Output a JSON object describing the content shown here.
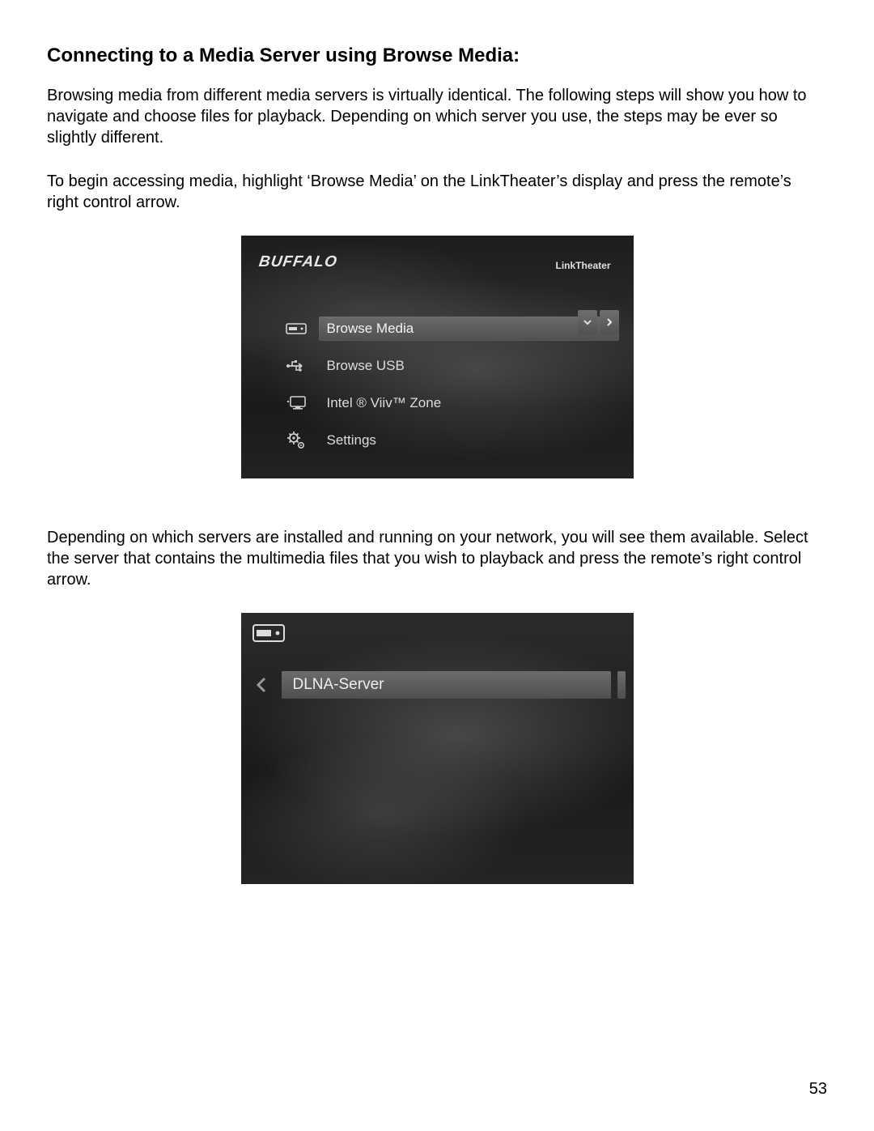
{
  "heading": "Connecting to a Media Server using Browse Media:",
  "para1": "Browsing media from different media servers is virtually identical.  The following steps will show you how to navigate and choose files for playback.  Depending on which server you use, the steps may be ever so slightly different.",
  "para2": "To begin accessing media, highlight ‘Browse Media’ on the LinkTheater’s display and press the remote’s right control arrow.",
  "para3": "Depending on which servers are installed and running on your network, you will see them available.  Select the server that contains the multimedia files that you wish to playback and press the remote’s right control arrow.",
  "page_number": "53",
  "screen1": {
    "brand": "BUFFALO",
    "product": "LinkTheater",
    "menu": [
      {
        "label": "Browse Media",
        "icon": "server-icon",
        "selected": true
      },
      {
        "label": "Browse USB",
        "icon": "usb-icon",
        "selected": false
      },
      {
        "label": "Intel ® Viiv™ Zone",
        "icon": "monitor-icon",
        "selected": false
      },
      {
        "label": "Settings",
        "icon": "gear-icon",
        "selected": false
      }
    ]
  },
  "screen2": {
    "header_icon": "server-icon",
    "item_label": "DLNA-Server"
  }
}
